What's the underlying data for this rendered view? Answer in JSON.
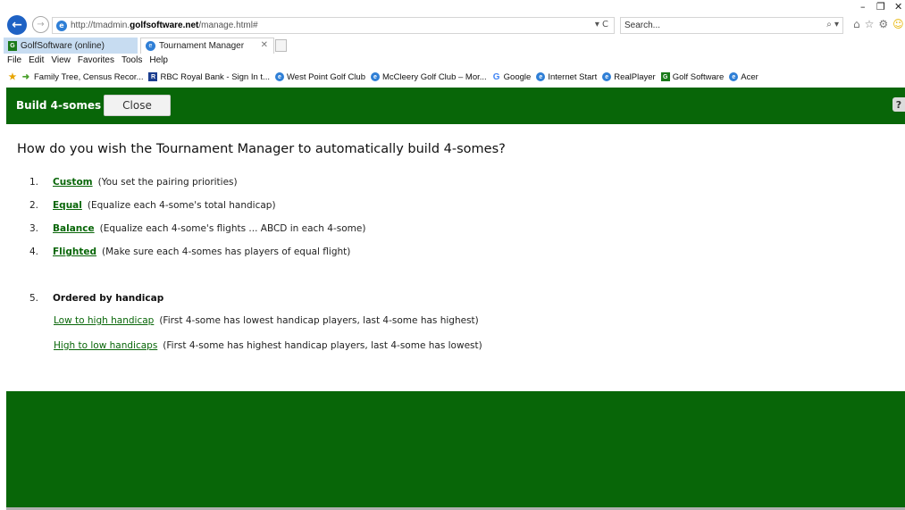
{
  "browser": {
    "url_prefix": "http://tmadmin.",
    "url_domain": "golfsoftware.net",
    "url_suffix": "/manage.html#",
    "addr_controls": "▾ C",
    "search_placeholder": "Search...",
    "search_controls": "⌕ ▾",
    "window_controls": {
      "minimize": "–",
      "restore": "❐",
      "close": "✕"
    },
    "tabs": [
      {
        "label": "GolfSoftware (online)",
        "icon": "golf-software-icon"
      },
      {
        "label": "Tournament Manager",
        "icon": "ie-icon"
      }
    ],
    "menu": [
      "File",
      "Edit",
      "View",
      "Favorites",
      "Tools",
      "Help"
    ],
    "favorites": [
      {
        "label": "Family Tree, Census Recor...",
        "icon": "arrow-icon"
      },
      {
        "label": "RBC Royal Bank - Sign In t...",
        "icon": "rbc-icon"
      },
      {
        "label": "West Point Golf Club",
        "icon": "ie-icon"
      },
      {
        "label": "McCleery Golf Club – Mor...",
        "icon": "ie-icon"
      },
      {
        "label": "Google",
        "icon": "google-icon"
      },
      {
        "label": "Internet Start",
        "icon": "ie-icon"
      },
      {
        "label": "RealPlayer",
        "icon": "ie-icon"
      },
      {
        "label": "Golf Software",
        "icon": "golf-software-icon"
      },
      {
        "label": "Acer",
        "icon": "ie-icon"
      }
    ]
  },
  "app": {
    "header": {
      "title": "Build 4-somes",
      "close_label": "Close",
      "help_glyph": "?"
    },
    "question": "How do you wish the Tournament Manager to automatically build 4-somes?",
    "options": [
      {
        "num": "1.",
        "link": "Custom",
        "desc": "(You set the pairing priorities)"
      },
      {
        "num": "2.",
        "link": "Equal",
        "desc": "(Equalize each 4-some's total handicap)"
      },
      {
        "num": "3.",
        "link": "Balance",
        "desc": "(Equalize each 4-some's flights ... ABCD in each 4-some)"
      },
      {
        "num": "4.",
        "link": "Flighted",
        "desc": "(Make sure each 4-somes has players of equal flight)"
      }
    ],
    "ordered": {
      "num": "5.",
      "label": "Ordered by handicap",
      "items": [
        {
          "link": "Low to high handicap",
          "desc": "(First 4-some has lowest handicap players, last 4-some has highest)"
        },
        {
          "link": "High to low handicaps",
          "desc": "(First 4-some has highest handicap players, last 4-some has lowest)"
        }
      ]
    },
    "colors": {
      "brand_green": "#086608",
      "link_green": "#086608"
    }
  }
}
